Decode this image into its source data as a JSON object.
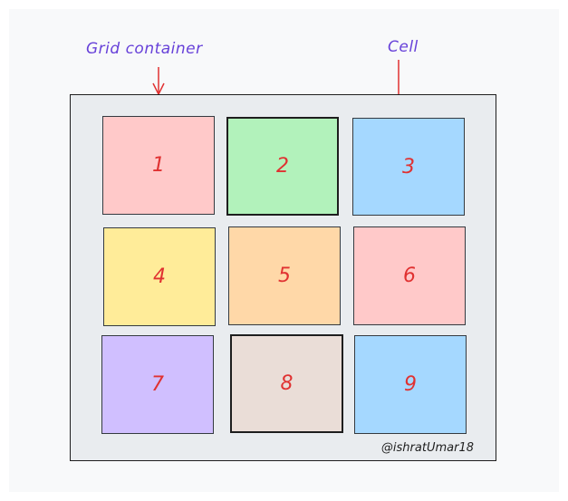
{
  "labels": {
    "grid_container": "Grid container",
    "cell": "Cell"
  },
  "colors": {
    "label": "#6741d9",
    "arrow": "#e03131",
    "container_bg": "#e9ecef",
    "number": "#e03131"
  },
  "cells": [
    {
      "label": "1",
      "color": "#ffc9c9"
    },
    {
      "label": "2",
      "color": "#b2f2bb"
    },
    {
      "label": "3",
      "color": "#a5d8ff"
    },
    {
      "label": "4",
      "color": "#ffec99"
    },
    {
      "label": "5",
      "color": "#ffd8a8"
    },
    {
      "label": "6",
      "color": "#ffc9c9"
    },
    {
      "label": "7",
      "color": "#d0bfff"
    },
    {
      "label": "8",
      "color": "#eaddd7"
    },
    {
      "label": "9",
      "color": "#a5d8ff"
    }
  ],
  "watermark": "@ishratUmar18"
}
